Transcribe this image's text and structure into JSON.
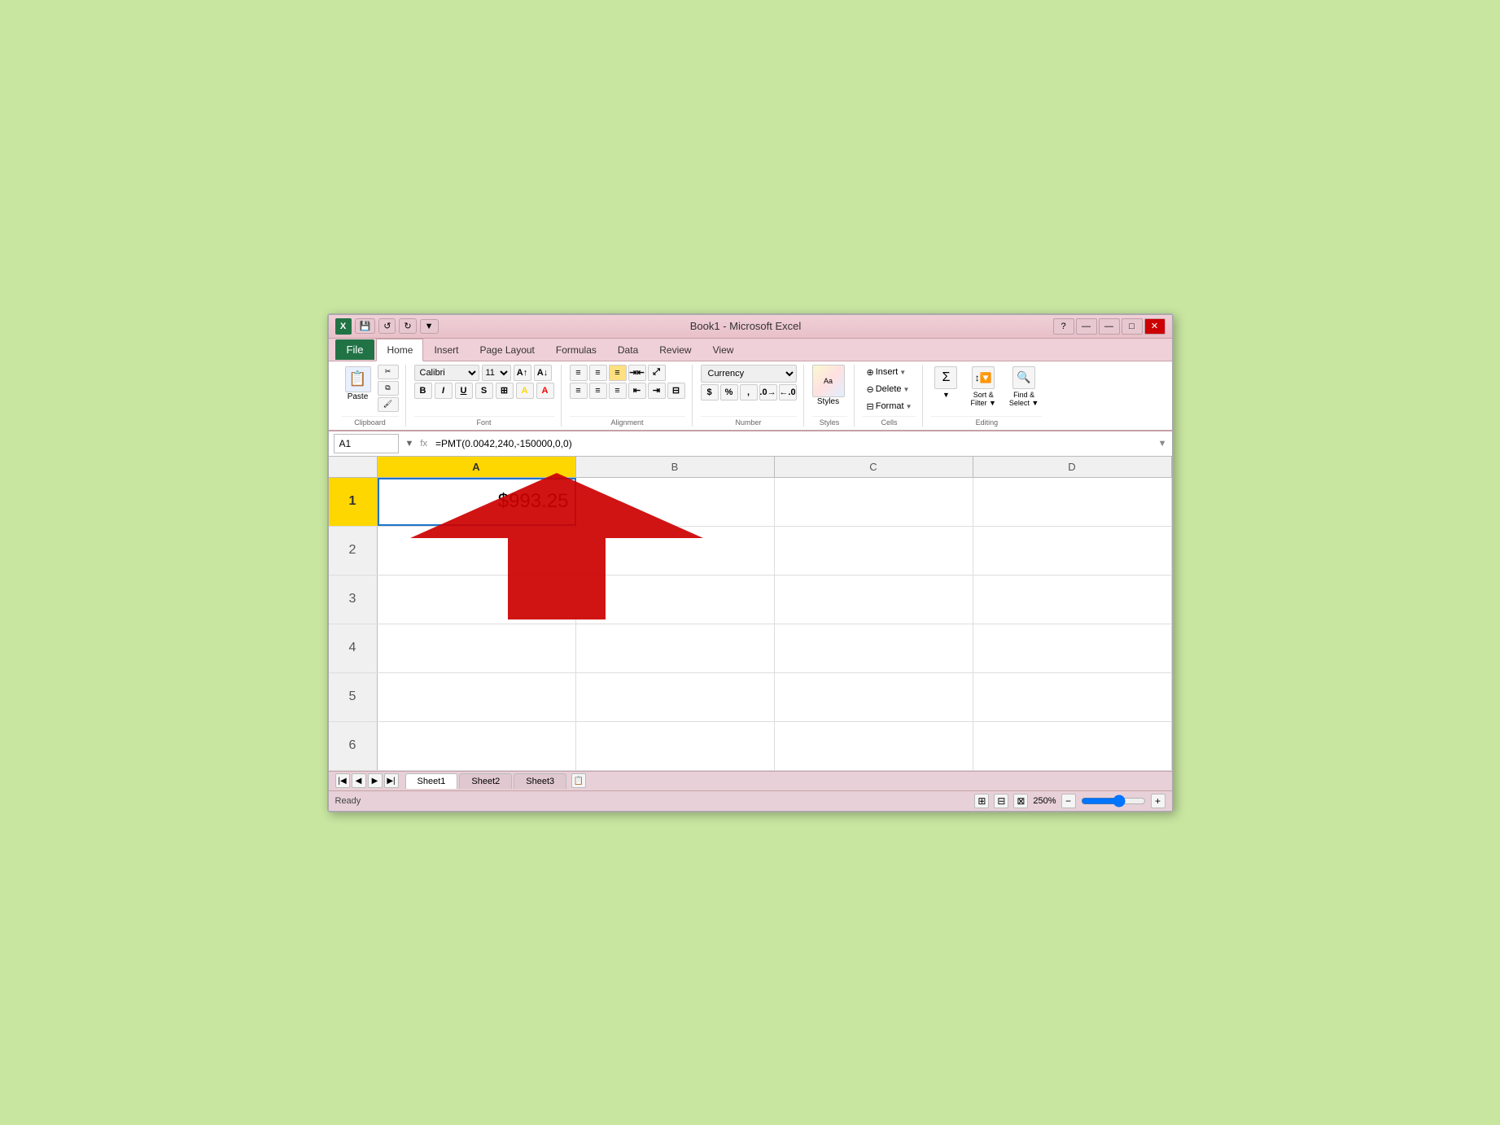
{
  "window": {
    "title": "Book1 - Microsoft Excel",
    "icon": "X",
    "minimize": "—",
    "maximize": "□",
    "close": "✕"
  },
  "titlebar_controls": {
    "save": "💾",
    "undo": "↺",
    "redo": "↻",
    "dropdown": "▼"
  },
  "ribbon_tabs": [
    "Home",
    "Insert",
    "Page Layout",
    "Formulas",
    "Data",
    "Review",
    "View"
  ],
  "active_tab": "Home",
  "clipboard": {
    "label": "Clipboard",
    "paste": "Paste",
    "cut": "✂",
    "copy": "⧉",
    "format_painter": "🖌"
  },
  "font": {
    "label": "Font",
    "name": "Calibri",
    "size": "11",
    "bold": "B",
    "italic": "I",
    "underline": "U",
    "strikethrough": "S",
    "border": "⊞",
    "fill_color": "A",
    "font_color": "A"
  },
  "alignment": {
    "label": "Alignment",
    "top_left": "≡",
    "top_center": "≡",
    "top_right": "≡",
    "wrap": "⇥",
    "bottom_left": "≡",
    "bottom_center": "≡",
    "bottom_right": "≡",
    "merge": "⊟",
    "indent_decrease": "⇤",
    "indent_increase": "⇥"
  },
  "number": {
    "label": "Number",
    "format": "Currency",
    "dollar": "$",
    "percent": "%",
    "comma": ",",
    "increase_decimal": ".0→",
    "decrease_decimal": "←.0"
  },
  "styles": {
    "label": "Styles",
    "name": "Styles"
  },
  "cells": {
    "label": "Cells",
    "insert": "Insert",
    "delete": "Delete",
    "format": "Format",
    "insert_arrow": "▼",
    "delete_arrow": "▼",
    "format_arrow": "▼"
  },
  "editing": {
    "label": "Editing",
    "sum": "Σ",
    "sum_arrow": "▼",
    "sort_filter": "Sort &\nFilter",
    "sort_arrow": "▼",
    "find_select": "Find &\nSelect",
    "find_arrow": "▼"
  },
  "formula_bar": {
    "cell_ref": "A1",
    "formula": "=PMT(0.0042,240,-150000,0,0)"
  },
  "columns": [
    "A",
    "B",
    "C",
    "D"
  ],
  "rows": [
    {
      "num": "1",
      "cells": [
        "$993.25",
        "",
        "",
        ""
      ]
    },
    {
      "num": "2",
      "cells": [
        "",
        "",
        "",
        ""
      ]
    },
    {
      "num": "3",
      "cells": [
        "",
        "",
        "",
        ""
      ]
    },
    {
      "num": "4",
      "cells": [
        "",
        "",
        "",
        ""
      ]
    },
    {
      "num": "5",
      "cells": [
        "",
        "",
        "",
        ""
      ]
    },
    {
      "num": "6",
      "cells": [
        "",
        "",
        "",
        ""
      ]
    }
  ],
  "sheet_tabs": [
    "Sheet1",
    "Sheet2",
    "Sheet3"
  ],
  "active_sheet": "Sheet1",
  "status": {
    "ready": "Ready",
    "zoom": "250%"
  }
}
